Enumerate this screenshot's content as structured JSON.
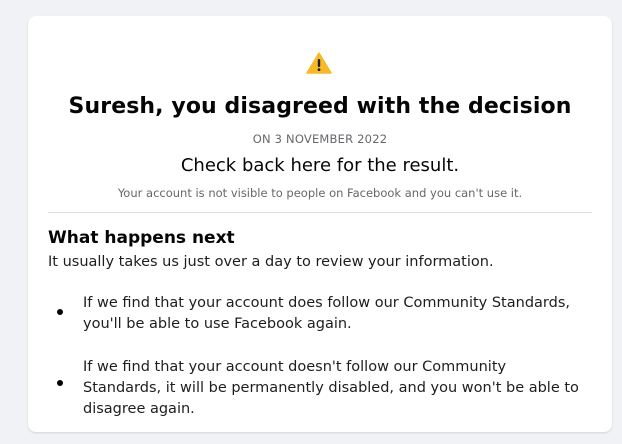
{
  "header": {
    "icon": "warning-icon",
    "headline": "Suresh, you disagreed with the decision",
    "date": "ON 3 NOVEMBER 2022",
    "check_back": "Check back here for the result.",
    "visibility_note": "Your account is not visible to people on Facebook and you can't use it."
  },
  "next_steps": {
    "title": "What happens next",
    "intro": "It usually takes us just over a day to review your information.",
    "items": [
      {
        "text": "If we find that your account does follow our Community Standards, you'll be able to use Facebook again."
      },
      {
        "text": "If we find that your account doesn't follow our Community Standards, it will be permanently disabled, and you won't be able to disagree again."
      }
    ]
  },
  "colors": {
    "background": "#f0f2f5",
    "card": "#ffffff",
    "warning": "#f7b928",
    "secondary_text": "#65676b",
    "divider": "#dadde1"
  }
}
